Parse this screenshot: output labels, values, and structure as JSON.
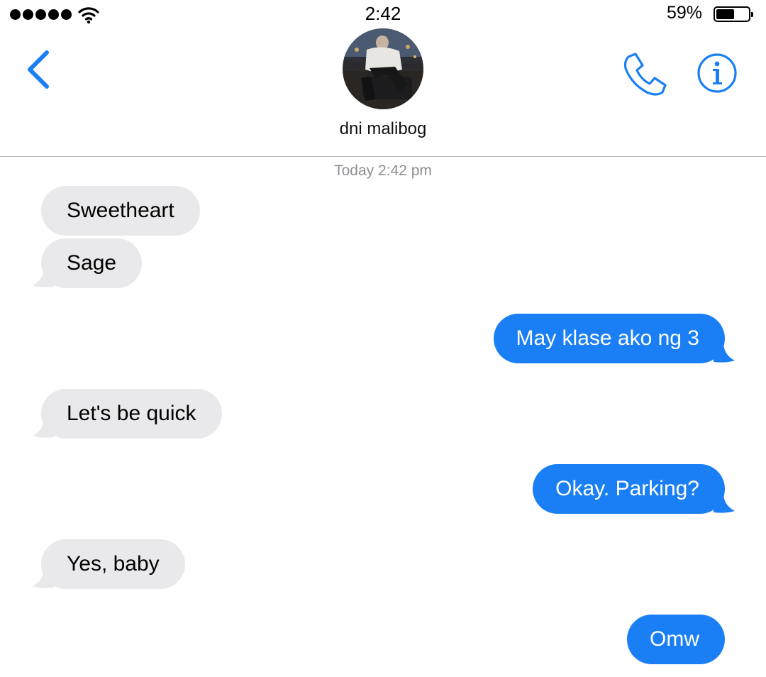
{
  "status_bar": {
    "time": "2:42",
    "battery_percent_label": "59%",
    "battery_level": 0.59,
    "signal_bars": 5
  },
  "header": {
    "contact_name": "dni malibog",
    "icons": [
      "back-chevron-icon",
      "phone-icon",
      "info-icon"
    ]
  },
  "conversation": {
    "timestamp": "Today 2:42 pm",
    "messages": [
      {
        "direction": "incoming",
        "text": "Sweetheart"
      },
      {
        "direction": "incoming",
        "text": "Sage"
      },
      {
        "direction": "outgoing",
        "text": "May klase ako ng 3"
      },
      {
        "direction": "incoming",
        "text": "Let's be quick"
      },
      {
        "direction": "outgoing",
        "text": "Okay. Parking?"
      },
      {
        "direction": "incoming",
        "text": "Yes, baby"
      },
      {
        "direction": "outgoing",
        "text": "Omw"
      }
    ]
  },
  "colors": {
    "accent_blue": "#1a7ff5",
    "incoming_bubble": "#e9e9eb",
    "timestamp_gray": "#8e8e93"
  }
}
